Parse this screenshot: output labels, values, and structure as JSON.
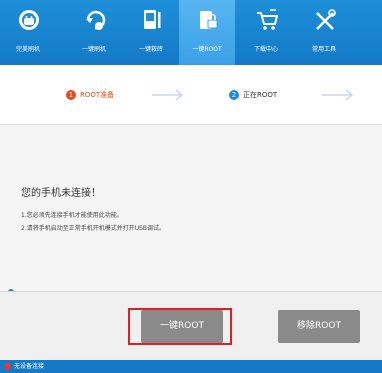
{
  "nav": {
    "items": [
      {
        "label": "完美刷机",
        "icon": "android-icon",
        "active": false
      },
      {
        "label": "一键刷机",
        "icon": "refresh-icon",
        "active": false
      },
      {
        "label": "一键救砖",
        "icon": "phone-fix-icon",
        "active": false
      },
      {
        "label": "一键ROOT",
        "icon": "root-lock-icon",
        "active": true
      },
      {
        "label": "下载中心",
        "icon": "cart-icon",
        "active": false
      },
      {
        "label": "常用工具",
        "icon": "tools-icon",
        "active": false
      }
    ]
  },
  "steps": [
    {
      "num": "1",
      "label": "ROOT准备",
      "color": "#e64a19"
    },
    {
      "num": "2",
      "label": "正在ROOT",
      "color": "#1e88e5"
    }
  ],
  "message": {
    "title": "您的手机未连接！",
    "lines": [
      "1.您必须先连接手机才能使用此功能。",
      "2.请将手机启动至正常手机开机模式并打开USB调试。"
    ]
  },
  "buttons": {
    "root": "一键ROOT",
    "remove": "移除ROOT"
  },
  "status": {
    "text": "无设备连接"
  },
  "colors": {
    "accent": "#1479c6",
    "highlight": "#e02020"
  }
}
